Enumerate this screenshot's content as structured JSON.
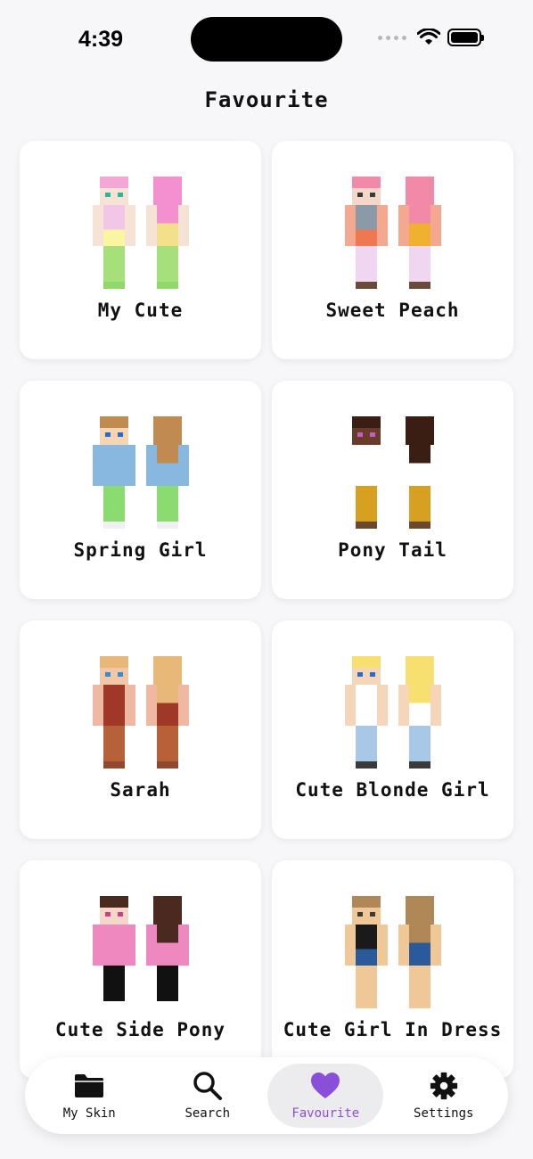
{
  "status_bar": {
    "time": "4:39"
  },
  "page_title": "Favourite",
  "skins": [
    {
      "name": "My Cute",
      "hair": "#f4a6d6",
      "skin": "#f7e3d6",
      "shirt": "#f2c6e6",
      "shirt2": "#fbf4a0",
      "arm": "#f7e3d6",
      "legs": "#a6e07a",
      "feet": "#8fd86a",
      "back_hair": "#f48fd0",
      "back_body": "#f4e08a",
      "eye": "#2ab6a0"
    },
    {
      "name": "Sweet Peach",
      "hair": "#f08aa8",
      "skin": "#f5d6c8",
      "shirt": "#8a9aa8",
      "shirt2": "#f07850",
      "arm": "#f5a890",
      "legs": "#f0d6f0",
      "feet": "#6a4a3a",
      "back_hair": "#f08aa8",
      "back_body": "#f0b030",
      "eye": "#3a3a3a"
    },
    {
      "name": "Spring Girl",
      "hair": "#c08a50",
      "skin": "#f5d6b0",
      "shirt": "#88b8e0",
      "shirt2": "#88b8e0",
      "arm": "#88b8e0",
      "legs": "#8adc70",
      "feet": "#f0f0f0",
      "back_hair": "#c08a50",
      "back_body": "#88b8e0",
      "eye": "#2a6ad0"
    },
    {
      "name": "Pony Tail",
      "hair": "#3a1e14",
      "skin": "#6a3a2a",
      "shirt": "#ffffff",
      "shirt2": "#ffffff",
      "arm": "#ffffff",
      "legs": "#d8a020",
      "feet": "#6a4a2a",
      "back_hair": "#3a1e14",
      "back_body": "#ffffff",
      "eye": "#c060c0"
    },
    {
      "name": "Sarah",
      "hair": "#e8b878",
      "skin": "#f0c8a8",
      "shirt": "#a03828",
      "shirt2": "#a03828",
      "arm": "#f0b8a0",
      "legs": "#b86038",
      "feet": "#904830",
      "back_hair": "#e8b878",
      "back_body": "#a03828",
      "eye": "#3a8ad0"
    },
    {
      "name": "Cute Blonde Girl",
      "hair": "#f8e070",
      "skin": "#f5d6b8",
      "shirt": "#ffffff",
      "shirt2": "#ffffff",
      "arm": "#f5d6b8",
      "legs": "#a8c8e8",
      "feet": "#3a3a3a",
      "back_hair": "#f8e070",
      "back_body": "#ffffff",
      "eye": "#2a6ad0"
    },
    {
      "name": "Cute Side Pony",
      "hair": "#4a2a1e",
      "skin": "#f5d6c8",
      "shirt": "#f088c0",
      "shirt2": "#f088c0",
      "arm": "#f088c0",
      "legs": "#111111",
      "feet": "#ffffff",
      "back_hair": "#4a2a1e",
      "back_body": "#f088c0",
      "eye": "#d04080"
    },
    {
      "name": "Cute Girl In Dress",
      "hair": "#b08858",
      "skin": "#f0c898",
      "shirt": "#1a1a1a",
      "shirt2": "#2a5a9a",
      "arm": "#f0c898",
      "legs": "#f0c898",
      "feet": "#f0c898",
      "back_hair": "#b08858",
      "back_body": "#2a5a9a",
      "eye": "#3a3a3a"
    }
  ],
  "tabs": [
    {
      "label": "My Skin",
      "icon": "folder-icon"
    },
    {
      "label": "Search",
      "icon": "search-icon"
    },
    {
      "label": "Favourite",
      "icon": "heart-icon",
      "active": true
    },
    {
      "label": "Settings",
      "icon": "gear-icon"
    }
  ],
  "colors": {
    "accent": "#8a4fd8",
    "background": "#f7f7f9"
  }
}
